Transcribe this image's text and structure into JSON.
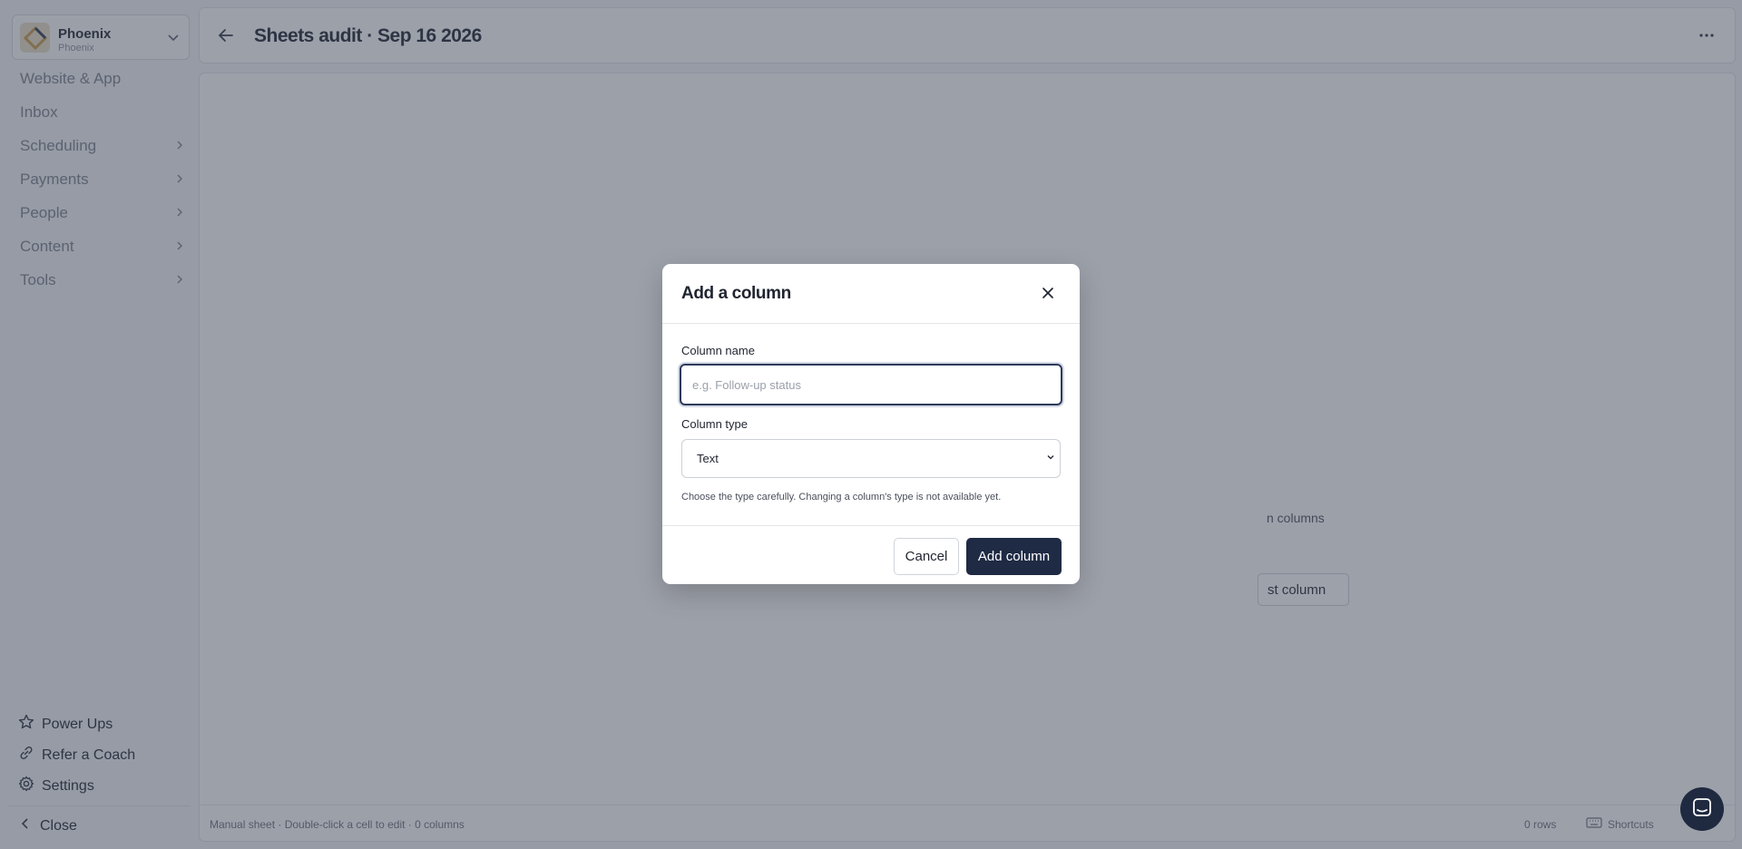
{
  "workspace": {
    "name": "Phoenix",
    "sub": "Phoenix"
  },
  "nav": [
    {
      "label": "Website & App",
      "chevron": false
    },
    {
      "label": "Inbox",
      "chevron": false
    },
    {
      "label": "Scheduling",
      "chevron": true
    },
    {
      "label": "Payments",
      "chevron": true
    },
    {
      "label": "People",
      "chevron": true
    },
    {
      "label": "Content",
      "chevron": true
    },
    {
      "label": "Tools",
      "chevron": true
    }
  ],
  "footer": {
    "power_ups": "Power Ups",
    "refer": "Refer a Coach",
    "settings": "Settings",
    "close": "Close"
  },
  "header": {
    "title": "Sheets audit · Sep 16 2026"
  },
  "empty": {
    "desc_partial": "n columns",
    "button_partial": "st column"
  },
  "status": {
    "left": "Manual sheet  · Double-click a cell to edit  · 0 columns",
    "rows": "0 rows",
    "shortcuts": "Shortcuts"
  },
  "modal": {
    "title": "Add a column",
    "name_label": "Column name",
    "name_placeholder": "e.g. Follow-up status",
    "name_value": "",
    "type_label": "Column type",
    "type_value": "Text",
    "hint": "Choose the type carefully. Changing a column's type is not available yet.",
    "cancel": "Cancel",
    "submit": "Add column"
  },
  "colors": {
    "primary": "#1f2a44",
    "overlay": "rgba(60,68,86,0.5)"
  }
}
